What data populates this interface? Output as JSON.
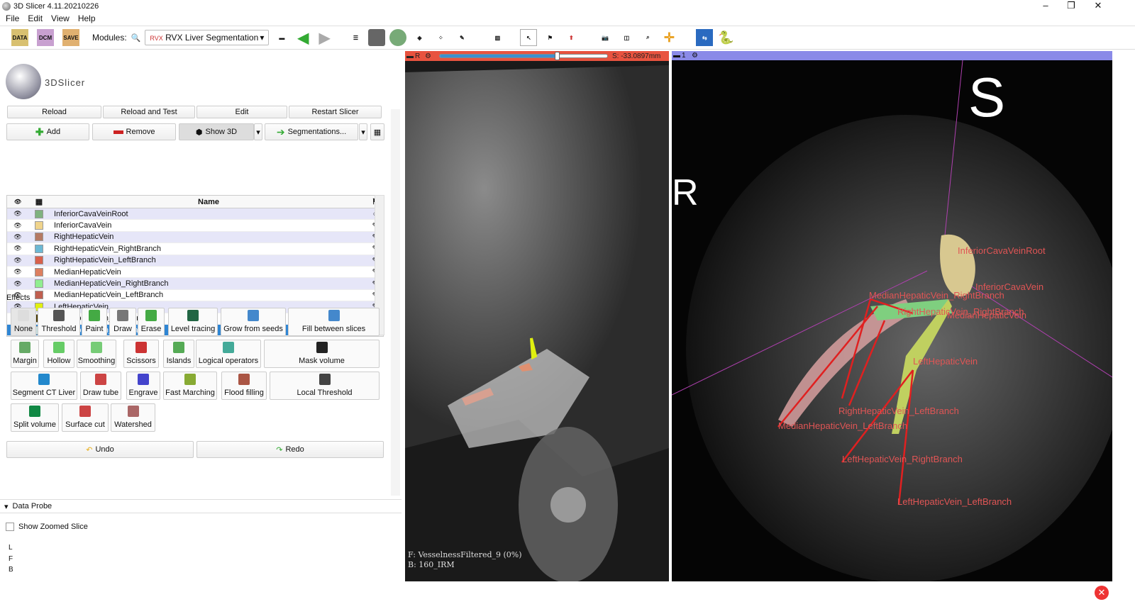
{
  "window": {
    "title": "3D Slicer 4.11.20210226",
    "controls": [
      "–",
      "❐",
      "✕"
    ]
  },
  "menu": [
    "File",
    "Edit",
    "View",
    "Help"
  ],
  "toolbar": {
    "data": "DATA",
    "dcm": "DCM",
    "save": "SAVE",
    "modules_label": "Modules:",
    "module_selected": "RVX Liver Segmentation",
    "module_prefix": "RVX"
  },
  "panel": {
    "logo_text": "3DSlicer",
    "dev_buttons": [
      "Reload",
      "Reload and Test",
      "Edit",
      "Restart Slicer"
    ],
    "add": "Add",
    "remove": "Remove",
    "show3d": "Show 3D",
    "segmentations": "Segmentations...",
    "table_header": "Name",
    "segments": [
      {
        "name": "InferiorCavaVeinRoot",
        "color": "#7fb27f",
        "state": "○"
      },
      {
        "name": "InferiorCavaVein",
        "color": "#f0d48c",
        "state": "✎"
      },
      {
        "name": "RightHepaticVein",
        "color": "#b57a64",
        "state": "✎"
      },
      {
        "name": "RightHepaticVein_RightBranch",
        "color": "#6bb8d4",
        "state": "✎"
      },
      {
        "name": "RightHepaticVein_LeftBranch",
        "color": "#d8604c",
        "state": "✎"
      },
      {
        "name": "MedianHepaticVein",
        "color": "#dd8060",
        "state": "✎"
      },
      {
        "name": "MedianHepaticVein_RightBranch",
        "color": "#90ee90",
        "state": "✎"
      },
      {
        "name": "MedianHepaticVein_LeftBranch",
        "color": "#c06050",
        "state": "✎"
      },
      {
        "name": "LeftHepaticVein",
        "color": "#e0f010",
        "state": "✎"
      },
      {
        "name": "LeftHepaticVein_RightBranch",
        "color": "#4a3a00",
        "state": "✎"
      },
      {
        "name": "LeftHepaticVein_LeftBranch",
        "color": "#c8e0e0",
        "state": "✎"
      }
    ],
    "selected_segment": "LeftHepaticVein_LeftBranch",
    "effects_label": "Effects",
    "effects": [
      "None",
      "Threshold",
      "Paint",
      "Draw",
      "Erase",
      "Level tracing",
      "Grow from seeds",
      "Fill between slices",
      "Margin",
      "Hollow",
      "Smoothing",
      "Scissors",
      "Islands",
      "Logical operators",
      "Mask volume",
      "Segment CT Liver",
      "Draw tube",
      "Engrave",
      "Fast Marching",
      "Flood filling",
      "Local Threshold",
      "Split volume",
      "Surface cut",
      "Watershed"
    ],
    "undo": "Undo",
    "redo": "Redo",
    "data_probe": "Data Probe",
    "show_zoomed": "Show Zoomed Slice",
    "probe_rows": [
      "L",
      "F",
      "B"
    ]
  },
  "slice": {
    "name": "R",
    "offset": "S: -33.0897mm",
    "slider_fraction": 0.7,
    "fg": "F: VesselnessFiltered_9 (0%)",
    "bg": "B: 160_IRM"
  },
  "threed": {
    "name": "1",
    "orient_S": "S",
    "orient_R": "R",
    "labels": [
      "InferiorCavaVeinRoot",
      "InferiorCavaVein",
      "MedianHepaticVein_RightBranch",
      "RightHepaticVein_RightBranch",
      "MedianHepaticVein",
      "LeftHepaticVein",
      "RightHepaticVein_LeftBranch",
      "MedianHepaticVein_LeftBranch",
      "LeftHepaticVein_RightBranch",
      "LeftHepaticVein_LeftBranch"
    ]
  }
}
